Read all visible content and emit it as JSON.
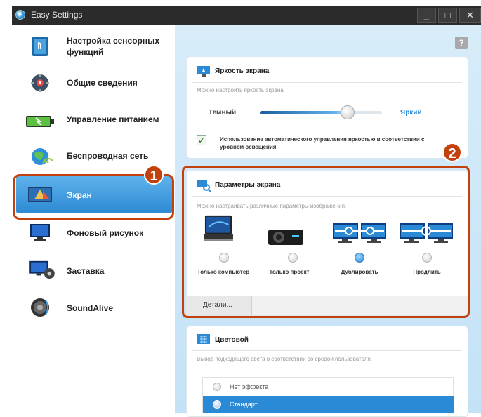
{
  "window": {
    "title": "Easy Settings",
    "minimize_label": "_",
    "maximize_label": "□",
    "close_label": "✕"
  },
  "sidebar": {
    "items": [
      {
        "label": "Настройка сенсорных функций",
        "icon": "touch-hand-icon"
      },
      {
        "label": "Общие сведения",
        "icon": "gear-icon"
      },
      {
        "label": "Управление питанием",
        "icon": "battery-icon"
      },
      {
        "label": "Беспроводная сеть",
        "icon": "wireless-globe-icon"
      },
      {
        "label": "Экран",
        "icon": "display-screen-icon",
        "selected": true
      },
      {
        "label": "Фоновый рисунок",
        "icon": "wallpaper-monitor-icon"
      },
      {
        "label": "Заставка",
        "icon": "screensaver-icon"
      },
      {
        "label": "SoundAlive",
        "icon": "speaker-icon"
      }
    ]
  },
  "badges": {
    "one": "1",
    "two": "2"
  },
  "help_label": "?",
  "brightness": {
    "title": "Яркость экрана",
    "description": "Можно настроить яркость экрана.",
    "dark_label": "Темный",
    "bright_label": "Яркий",
    "level_fraction": 0.67,
    "auto_checked": true,
    "auto_label": "Использование автоматического управления яркостью в соответствии с уровнем освещения"
  },
  "display": {
    "title": "Параметры экрана",
    "description": "Можно настраивать различные параметры изображения.",
    "modes": [
      {
        "label": "Только компьютер",
        "icon": "laptop-icon",
        "selected": false
      },
      {
        "label": "Только проект",
        "icon": "projector-icon",
        "selected": false
      },
      {
        "label": "Дублировать",
        "icon": "duplicate-monitors-icon",
        "selected": true
      },
      {
        "label": "Продлить",
        "icon": "extend-monitors-icon",
        "selected": false
      }
    ],
    "details_label": "Детали..."
  },
  "color": {
    "title": "Цветовой",
    "description": "Вывод подходящего света в соответствии со средой пользователя.",
    "effects": [
      {
        "label": "Нет эффекта",
        "selected": false
      },
      {
        "label": "Стандарт",
        "selected": true
      }
    ]
  },
  "colors": {
    "accent": "#2a8ad6",
    "highlight": "#c2410c"
  }
}
